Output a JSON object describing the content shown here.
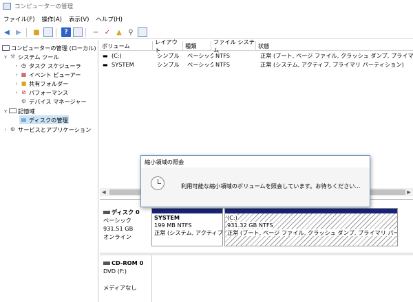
{
  "window": {
    "title": "コンピューターの管理"
  },
  "menu": [
    "ファイル(F)",
    "操作(A)",
    "表示(V)",
    "ヘルプ(H)"
  ],
  "toolbar": {
    "back_icon": "back-arrow-icon",
    "forward_icon": "forward-arrow-icon",
    "help_label": "?"
  },
  "tree": {
    "root": "コンピューターの管理 (ローカル)",
    "system_tools": "システム ツール",
    "task_scheduler": "タスク スケジューラ",
    "event_viewer": "イベント ビューアー",
    "shared_folders": "共有フォルダー",
    "performance": "パフォーマンス",
    "device_manager": "デバイス マネージャー",
    "storage": "記憶域",
    "disk_management": "ディスクの管理",
    "services": "サービスとアプリケーション"
  },
  "volumes": {
    "headers": [
      "ボリューム",
      "レイアウト",
      "種類",
      "ファイル システム",
      "状態"
    ],
    "rows": [
      [
        "(C:)",
        "シンプル",
        "ベーシック",
        "NTFS",
        "正常 (ブート, ページ ファイル, クラッシュ ダンプ, プライマリ パーティ"
      ],
      [
        "SYSTEM",
        "シンプル",
        "ベーシック",
        "NTFS",
        "正常 (システム, アクティブ, プライマリ パーティション)"
      ]
    ]
  },
  "disks": {
    "disk0": {
      "name": "ディスク 0",
      "type": "ベーシック",
      "size": "931.51 GB",
      "status": "オンライン",
      "partitions": [
        {
          "name": "SYSTEM",
          "size": "199 MB NTFS",
          "status": "正常 (システム, アクティブ,"
        },
        {
          "name": "(C:)",
          "size": "931.32 GB NTFS",
          "status": "正常 (ブート, ページ ファイル, クラッシュ ダンプ, プライマリ パーティション)"
        }
      ]
    },
    "cdrom0": {
      "name": "CD-ROM 0",
      "type": "DVD (F:)",
      "status": "メディアなし"
    }
  },
  "dialog": {
    "title": "縮小領域の照会",
    "message": "利用可能な縮小領域のボリュームを照会しています。お待ちください..."
  },
  "colors": {
    "partition_bar": "#17237a",
    "selection": "#cce4f7",
    "dialog_border": "#6e93c2"
  }
}
